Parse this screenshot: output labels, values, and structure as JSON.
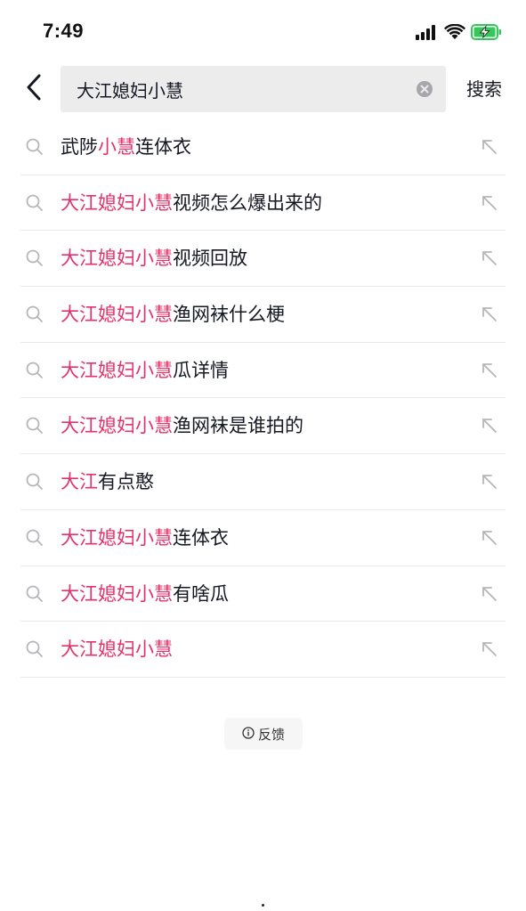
{
  "status_bar": {
    "time": "7:49",
    "icons": [
      "cellular-signal-icon",
      "wifi-icon",
      "battery-charging-icon"
    ],
    "battery_color": "#34c759"
  },
  "search": {
    "query": "大江媳妇小慧",
    "search_button_label": "搜索",
    "icons": [
      "back-chevron-icon",
      "clear-icon"
    ]
  },
  "colors": {
    "highlight": "#e4326a",
    "text": "#161823",
    "icon_gray": "#b5b6ba"
  },
  "suggestions": [
    {
      "highlight": [
        "",
        "小慧"
      ],
      "parts": [
        "武陟",
        "小慧",
        "连体衣"
      ]
    },
    {
      "parts": [
        "大江媳妇小慧",
        "视频怎么爆出来的"
      ]
    },
    {
      "parts": [
        "大江媳妇小慧",
        "视频回放"
      ]
    },
    {
      "parts": [
        "大江媳妇小慧",
        "渔网袜什么梗"
      ]
    },
    {
      "parts": [
        "大江媳妇小慧",
        "瓜详情"
      ]
    },
    {
      "parts": [
        "大江媳妇小慧",
        "渔网袜是谁拍的"
      ]
    },
    {
      "parts": [
        "大江",
        "有点憨"
      ]
    },
    {
      "parts": [
        "大江媳妇小慧",
        "连体衣"
      ]
    },
    {
      "parts": [
        "大江媳妇小慧",
        "有啥瓜"
      ]
    },
    {
      "parts": [
        "大江媳妇小慧",
        ""
      ]
    }
  ],
  "feedback": {
    "label": "反馈",
    "icon": "info-circle-icon"
  }
}
